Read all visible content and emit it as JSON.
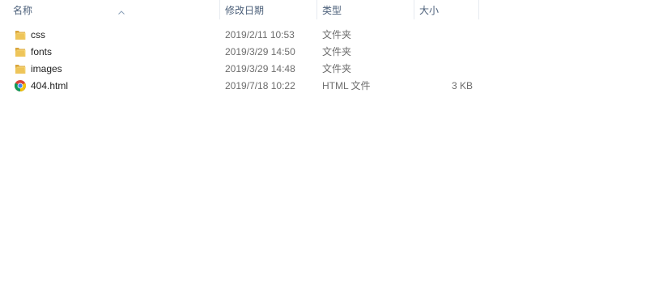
{
  "columns": {
    "name": "名称",
    "date": "修改日期",
    "type": "类型",
    "size": "大小"
  },
  "files": [
    {
      "name": "css",
      "date": "2019/2/11 10:53",
      "type": "文件夹",
      "size": "",
      "icon": "folder-icon"
    },
    {
      "name": "fonts",
      "date": "2019/3/29 14:50",
      "type": "文件夹",
      "size": "",
      "icon": "folder-icon"
    },
    {
      "name": "images",
      "date": "2019/3/29 14:48",
      "type": "文件夹",
      "size": "",
      "icon": "folder-icon"
    },
    {
      "name": "404.html",
      "date": "2019/7/18 10:22",
      "type": "HTML 文件",
      "size": "3 KB",
      "icon": "chrome-icon"
    }
  ],
  "colors": {
    "header_text": "#4c607a",
    "detail_text": "#6d6d6d",
    "folder": "#e8b84a"
  }
}
